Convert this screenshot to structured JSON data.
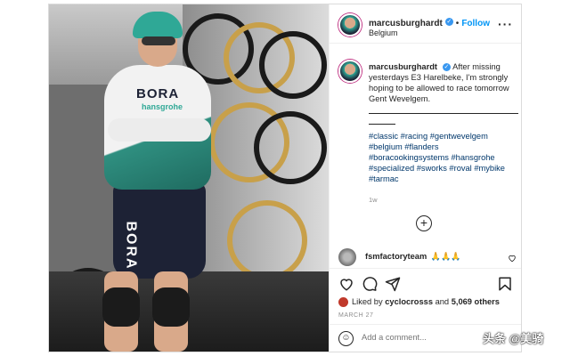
{
  "post": {
    "username": "marcusburghardt",
    "verified_mark": "✓",
    "separator": "•",
    "follow_label": "Follow",
    "location": "Belgium",
    "more_label": "···"
  },
  "caption": {
    "text": "After missing yesterdays E3 Harelbeke, I'm strongly hoping to be allowed to race tomorrow Gent Wevelgem.",
    "hashtags": "#classic #racing #gentwevelgem #belgium #flanders #boracookingsystems #hansgrohe #specialized #sworks #roval #mybike #tarmac",
    "age": "1w"
  },
  "load_more": "+",
  "comment": {
    "username": "fsmfactoryteam",
    "emoji": "🙏🙏🙏"
  },
  "actions": {
    "like_icon": "heart-icon",
    "comment_icon": "comment-icon",
    "share_icon": "share-icon",
    "save_icon": "bookmark-icon"
  },
  "likes": {
    "prefix": "Liked by",
    "user": "cyclocrosss",
    "and": "and",
    "count": "5,069 others"
  },
  "date": "MARCH 27",
  "add_comment": {
    "placeholder": "Add a comment..."
  },
  "photo": {
    "jersey_brand": "BORA",
    "jersey_sub": "hansgrohe",
    "shorts_brand": "BORA"
  },
  "watermark": "头条 @美骑",
  "colors": {
    "accent": "#0095f6",
    "hashtag": "#00376b",
    "team_teal": "#2fa896"
  }
}
